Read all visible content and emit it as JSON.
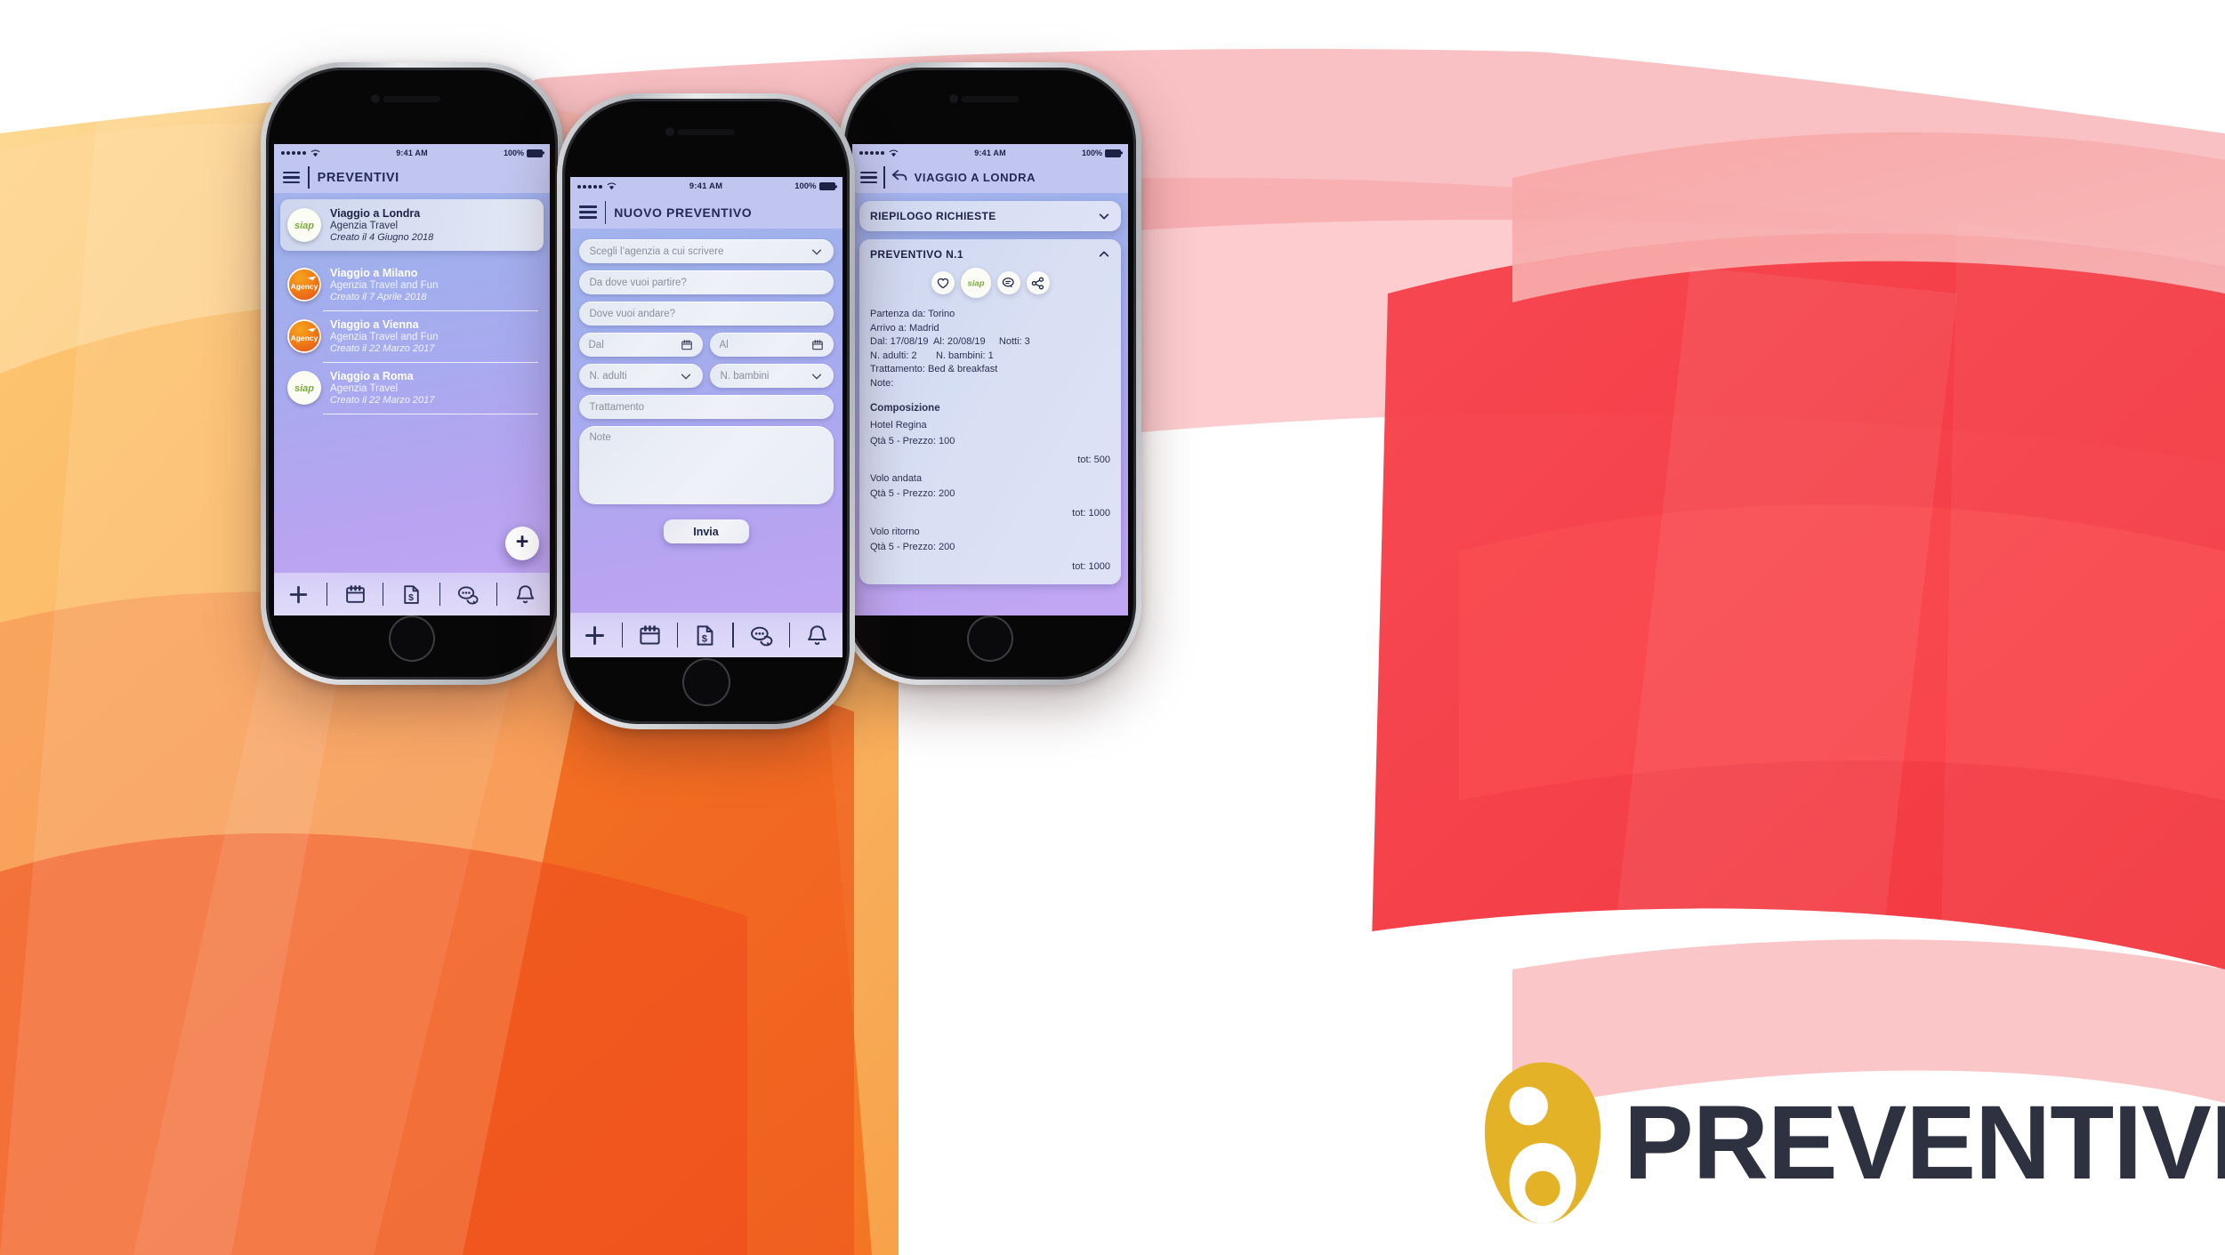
{
  "brand": {
    "logo_text": "PREVENTIVI",
    "logo_color": "#e4b226",
    "wordmark_color": "#2e3140"
  },
  "theme": {
    "screen_gradient_top": "#a8b6ee",
    "screen_gradient_bottom": "#c2a6f3",
    "navbar_bg": "#c0c6ef",
    "navbar_text": "#232a55",
    "tabbar_bg": "#dbd5f8",
    "bg_left": "#f47b20",
    "bg_right": "#f5333f",
    "siap_green": "#7aab3a"
  },
  "status_bar": {
    "signal_icon": "signal-dots-icon",
    "wifi_icon": "wifi-icon",
    "time": "9:41 AM",
    "battery_percent": "100%",
    "battery_icon": "battery-full-icon"
  },
  "tab_bar": {
    "items": [
      {
        "icon": "plus-icon",
        "name": "tab-new"
      },
      {
        "icon": "calendar-icon",
        "name": "tab-calendar"
      },
      {
        "icon": "invoice-dollar-icon",
        "name": "tab-quotes"
      },
      {
        "icon": "chat-bubbles-icon",
        "name": "tab-messages"
      },
      {
        "icon": "bell-icon",
        "name": "tab-notifications"
      }
    ]
  },
  "phone1": {
    "nav": {
      "menu_icon": "hamburger-menu-icon",
      "title": "PREVENTIVI"
    },
    "list": [
      {
        "title": "Viaggio a Londra",
        "agency": "Agenzia Travel",
        "created": "Creato il 4 Giugno 2018",
        "avatar": "siap-logo-icon",
        "active": true
      },
      {
        "title": "Viaggio a Milano",
        "agency": "Agenzia Travel and Fun",
        "created": "Creato il 7 Aprile 2018",
        "avatar": "agency-logo-icon",
        "active": false
      },
      {
        "title": "Viaggio a Vienna",
        "agency": "Agenzia Travel and Fun",
        "created": "Creato il 22 Marzo 2017",
        "avatar": "agency-logo-icon",
        "active": false
      },
      {
        "title": "Viaggio a Roma",
        "agency": "Agenzia Travel",
        "created": "Creato il 22 Marzo 2017",
        "avatar": "siap-logo-icon",
        "active": false
      }
    ],
    "fab": {
      "label": "+",
      "icon": "plus-icon"
    }
  },
  "phone2": {
    "nav": {
      "menu_icon": "hamburger-menu-icon",
      "title": "NUOVO PREVENTIVO"
    },
    "form": {
      "agency_select": {
        "placeholder": "Scegli l’agenzia a cui scrivere",
        "value": "",
        "icon": "chevron-down-icon"
      },
      "origin": {
        "placeholder": "Da dove vuoi partire?",
        "value": ""
      },
      "destination": {
        "placeholder": "Dove vuoi andare?",
        "value": ""
      },
      "date_from": {
        "placeholder": "Dal",
        "value": "",
        "icon": "calendar-icon"
      },
      "date_to": {
        "placeholder": "Al",
        "value": "",
        "icon": "calendar-icon"
      },
      "adults": {
        "placeholder": "N. adulti",
        "value": "",
        "icon": "chevron-down-icon"
      },
      "children": {
        "placeholder": "N. bambini",
        "value": "",
        "icon": "chevron-down-icon"
      },
      "board": {
        "placeholder": "Trattamento",
        "value": ""
      },
      "notes": {
        "placeholder": "Note",
        "value": ""
      },
      "submit_label": "Invia"
    }
  },
  "phone3": {
    "nav": {
      "menu_icon": "hamburger-menu-icon",
      "back_icon": "back-arrow-icon",
      "title": "VIAGGIO A LONDRA"
    },
    "summary_panel": {
      "title": "RIEPILOGO RICHIESTE",
      "icon": "chevron-down-icon",
      "expanded": false
    },
    "quote_panel": {
      "title": "PREVENTIVO N.1",
      "icon": "chevron-up-icon",
      "expanded": true,
      "actions": [
        {
          "icon": "heart-icon",
          "name": "favourite-action"
        },
        {
          "icon": "siap-logo-icon",
          "name": "agency-logo-action"
        },
        {
          "icon": "chat-bubble-icon",
          "name": "message-action"
        },
        {
          "icon": "share-icon",
          "name": "share-action"
        }
      ],
      "details": [
        "Partenza da: Torino",
        "Arrivo a: Madrid",
        "Dal: 17/08/19  Al: 20/08/19     Notti: 3",
        "N. adulti: 2       N. bambini: 1",
        "Trattamento: Bed & breakfast",
        "Note:"
      ],
      "composition_heading": "Composizione",
      "composition": [
        {
          "name": "Hotel Regina",
          "qty_price": "Qtà 5 -  Prezzo: 100",
          "total": "tot: 500"
        },
        {
          "name": "Volo andata",
          "qty_price": "Qtà 5 -  Prezzo: 200",
          "total": "tot: 1000"
        },
        {
          "name": "Volo ritorno",
          "qty_price": "Qtà 5 -  Prezzo: 200",
          "total": "tot: 1000"
        }
      ]
    }
  }
}
